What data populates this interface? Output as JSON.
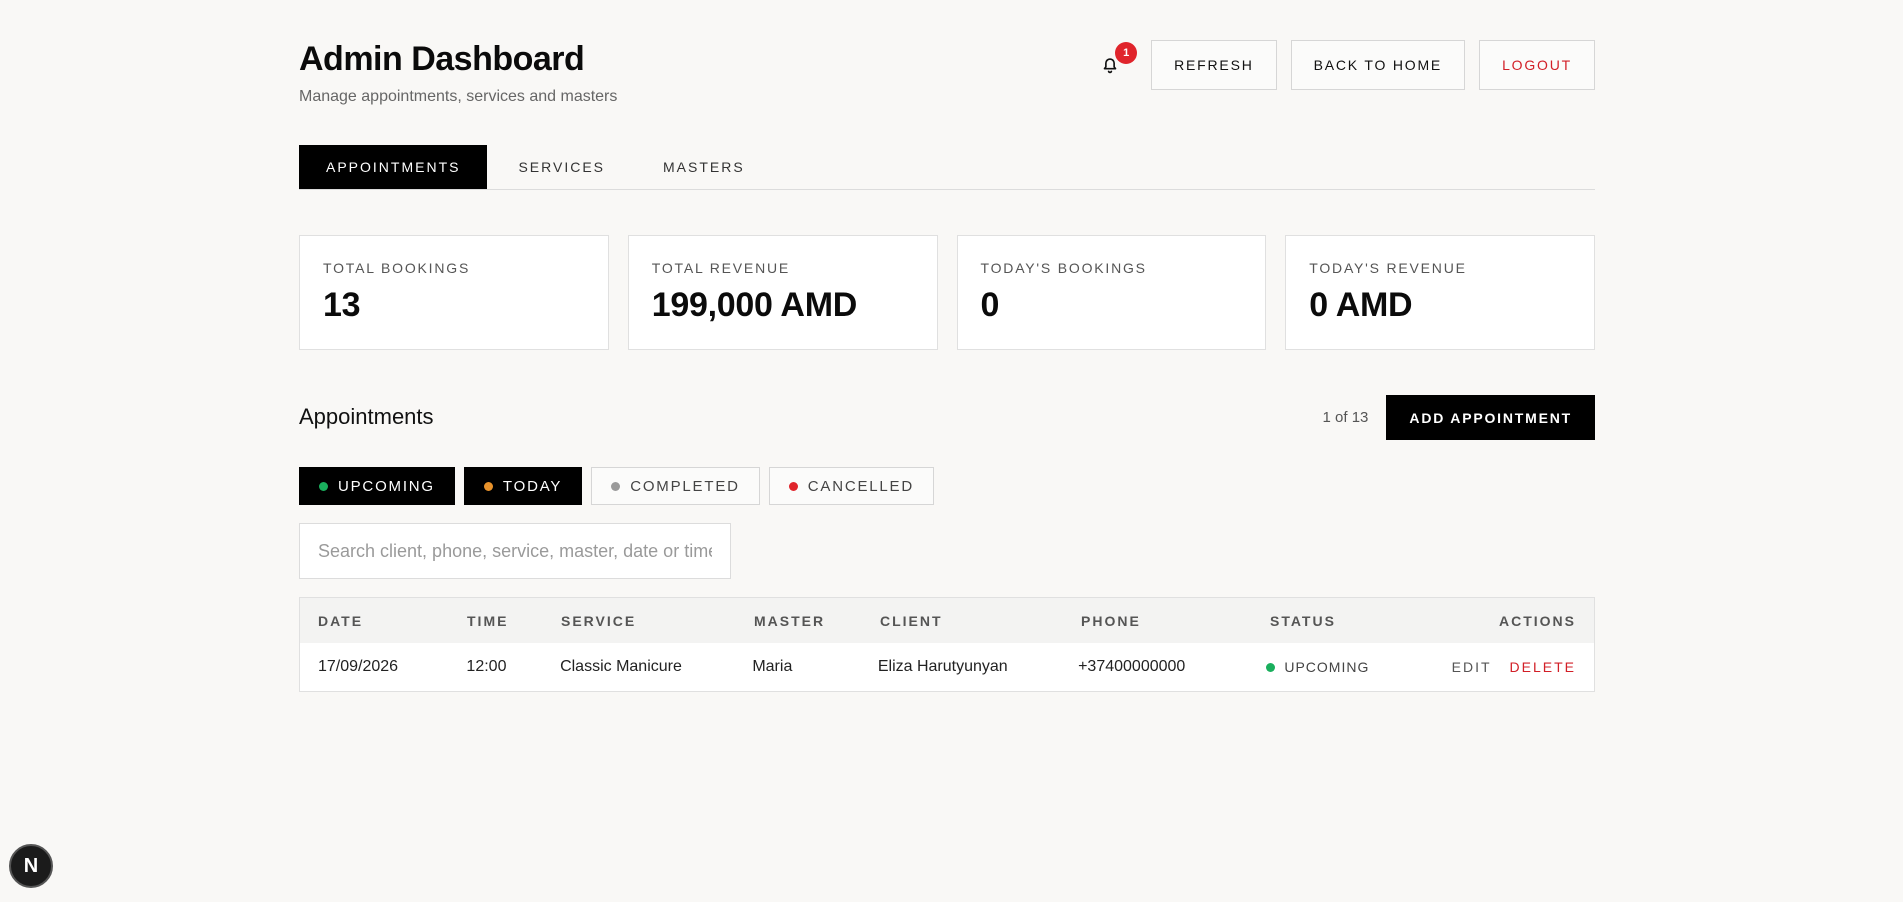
{
  "header": {
    "title": "Admin Dashboard",
    "subtitle": "Manage appointments, services and masters",
    "notification_count": "1",
    "refresh_label": "REFRESH",
    "back_label": "BACK TO HOME",
    "logout_label": "LOGOUT"
  },
  "tabs": [
    {
      "label": "APPOINTMENTS",
      "active": true
    },
    {
      "label": "SERVICES",
      "active": false
    },
    {
      "label": "MASTERS",
      "active": false
    }
  ],
  "stats": [
    {
      "label": "TOTAL BOOKINGS",
      "value": "13"
    },
    {
      "label": "TOTAL REVENUE",
      "value": "199,000 AMD"
    },
    {
      "label": "TODAY'S BOOKINGS",
      "value": "0"
    },
    {
      "label": "TODAY'S REVENUE",
      "value": "0 AMD"
    }
  ],
  "appointments": {
    "title": "Appointments",
    "count_text": "1 of 13",
    "add_label": "ADD APPOINTMENT",
    "filters": [
      {
        "label": "UPCOMING",
        "color": "#1aaf5d",
        "active": true
      },
      {
        "label": "TODAY",
        "color": "#e8922b",
        "active": true
      },
      {
        "label": "COMPLETED",
        "color": "#9a9a9a",
        "active": false
      },
      {
        "label": "CANCELLED",
        "color": "#e0242b",
        "active": false
      }
    ],
    "search_placeholder": "Search client, phone, service, master, date or time",
    "columns": [
      "DATE",
      "TIME",
      "SERVICE",
      "MASTER",
      "CLIENT",
      "PHONE",
      "STATUS",
      "ACTIONS"
    ],
    "rows": [
      {
        "date": "17/09/2026",
        "time": "12:00",
        "service": "Classic Manicure",
        "master": "Maria",
        "client": "Eliza Harutyunyan",
        "phone": "+37400000000",
        "status": "UPCOMING",
        "status_color": "#1aaf5d",
        "edit": "EDIT",
        "delete": "DELETE"
      }
    ]
  },
  "dev_badge": {
    "letter": "N"
  },
  "colors": {
    "accent": "#000000",
    "danger": "#d21f27",
    "background": "#f9f8f6"
  }
}
